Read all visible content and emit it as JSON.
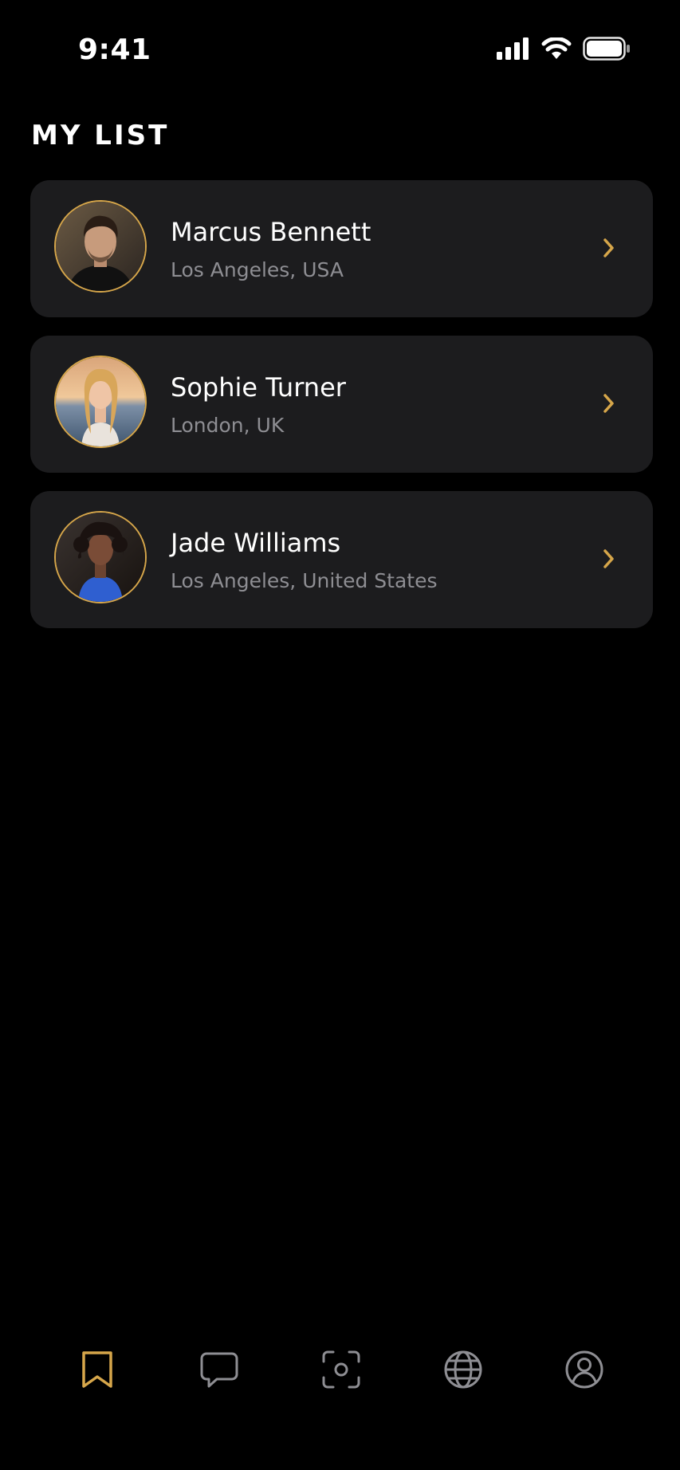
{
  "status_bar": {
    "time": "9:41",
    "icons": [
      "cellular-signal-icon",
      "wifi-icon",
      "battery-icon"
    ]
  },
  "page": {
    "title": "MY LIST"
  },
  "colors": {
    "background": "#000000",
    "card": "#1c1c1e",
    "accent": "#d6a64a",
    "secondary_text": "#8e8e93",
    "inactive_icon": "#8e8e93"
  },
  "list": {
    "items": [
      {
        "name": "Marcus Bennett",
        "location": "Los Angeles, USA",
        "avatar": "avatar-marcus"
      },
      {
        "name": "Sophie Turner",
        "location": "London, UK",
        "avatar": "avatar-sophie"
      },
      {
        "name": "Jade Williams",
        "location": "Los Angeles, United States",
        "avatar": "avatar-jade"
      }
    ]
  },
  "tab_bar": {
    "tabs": [
      {
        "icon": "bookmark-icon",
        "active": true
      },
      {
        "icon": "chat-bubble-icon",
        "active": false
      },
      {
        "icon": "scan-icon",
        "active": false
      },
      {
        "icon": "globe-icon",
        "active": false
      },
      {
        "icon": "profile-icon",
        "active": false
      }
    ]
  }
}
